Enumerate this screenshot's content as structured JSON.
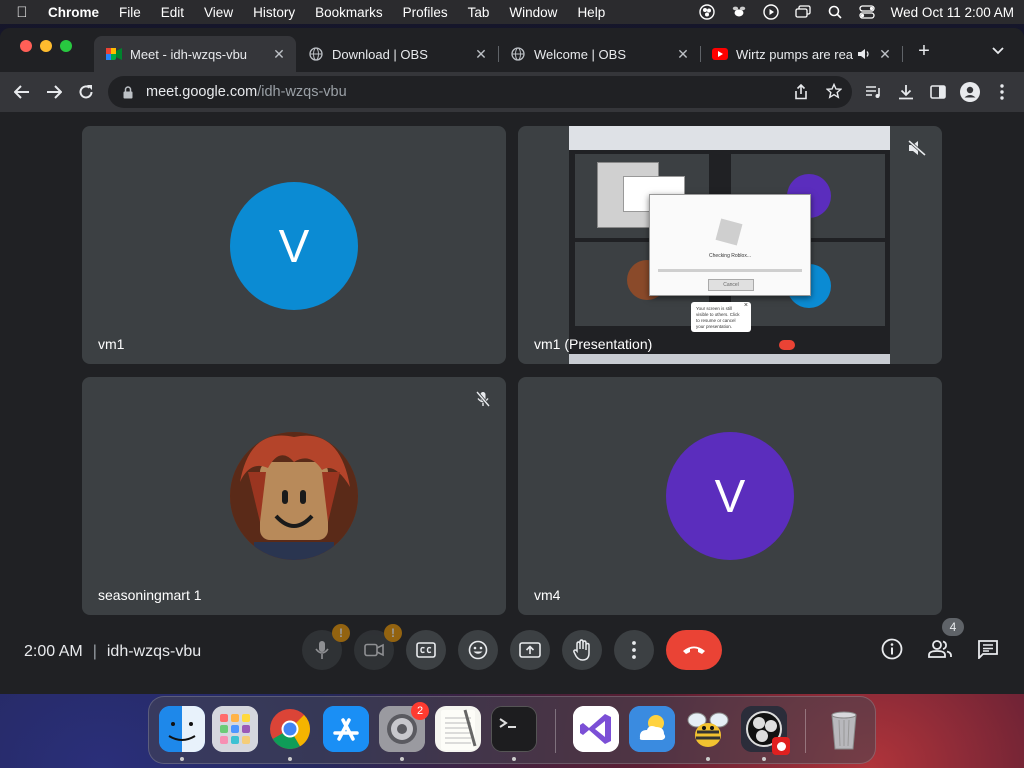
{
  "menubar": {
    "app": "Chrome",
    "items": [
      "File",
      "Edit",
      "View",
      "History",
      "Bookmarks",
      "Profiles",
      "Tab",
      "Window",
      "Help"
    ],
    "clock": "Wed Oct 11  2:00 AM"
  },
  "tabs": [
    {
      "title": "Meet - idh-wzqs-vbu",
      "icon": "google-meet-icon",
      "active": true
    },
    {
      "title": "Download | OBS",
      "icon": "globe-icon"
    },
    {
      "title": "Welcome | OBS",
      "icon": "globe-icon"
    },
    {
      "title": "Wirtz pumps are rea",
      "icon": "youtube-icon",
      "audio": true
    }
  ],
  "address": {
    "host": "meet.google.com",
    "path": "/idh-wzqs-vbu"
  },
  "tiles": [
    {
      "name": "vm1",
      "initial": "V",
      "color": "#0b8bd3"
    },
    {
      "name": "vm1 (Presentation)"
    },
    {
      "name": "seasoningmart 1",
      "muted": true
    },
    {
      "name": "vm4",
      "initial": "V",
      "color": "#5b2dbd"
    }
  ],
  "meeting": {
    "time": "2:00 AM",
    "separator": "|",
    "code": "idh-wzqs-vbu",
    "participants": "4"
  },
  "presentation_thumb": {
    "dialog_text": "Checking Roblox...",
    "dialog_button": "Cancel",
    "popup_text": "Your screen is still visible to others. Click to resume or cancel your presentation.",
    "popup_close": "×"
  },
  "dock": {
    "settings_badge": "2"
  },
  "colors": {
    "meet_bg": "#202124",
    "tile_bg": "#3c4043",
    "end_call": "#ea4335",
    "warning": "#f29900"
  }
}
